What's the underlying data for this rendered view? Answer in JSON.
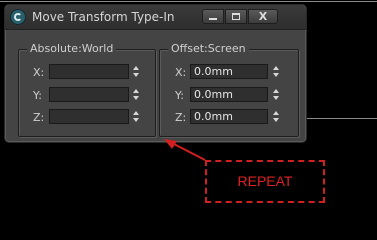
{
  "window": {
    "title": "Move Transform Type-In",
    "close_label": "X"
  },
  "absolute": {
    "title": "Absolute:World",
    "fields": [
      {
        "label": "X:",
        "value": ""
      },
      {
        "label": "Y:",
        "value": ""
      },
      {
        "label": "Z:",
        "value": ""
      }
    ]
  },
  "offset": {
    "title": "Offset:Screen",
    "fields": [
      {
        "label": "X:",
        "value": "0.0mm"
      },
      {
        "label": "Y:",
        "value": "0.0mm"
      },
      {
        "label": "Z:",
        "value": "0.0mm"
      }
    ]
  },
  "annotation": {
    "text": "REPEAT",
    "color": "#e02020"
  },
  "colors": {
    "dialog_bg": "#444444",
    "field_bg": "#2f2f2f",
    "accent_red": "#d21f1f"
  }
}
